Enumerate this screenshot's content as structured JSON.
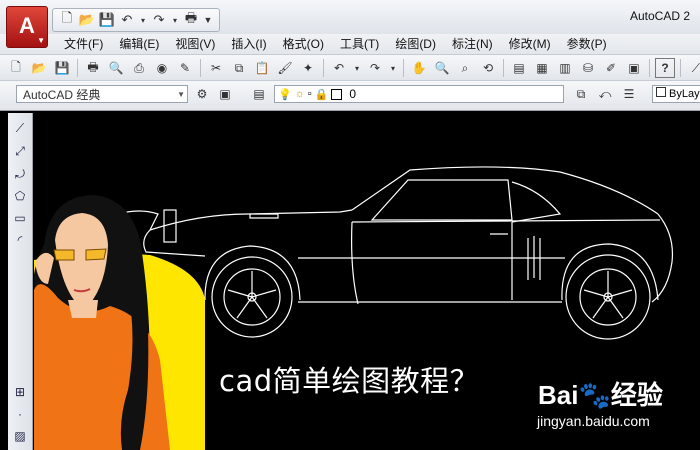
{
  "app": {
    "logo_letter": "A",
    "window_title": "AutoCAD 2"
  },
  "menu": {
    "items": [
      "文件(F)",
      "编辑(E)",
      "视图(V)",
      "插入(I)",
      "格式(O)",
      "工具(T)",
      "绘图(D)",
      "标注(N)",
      "修改(M)",
      "参数(P)"
    ]
  },
  "toolbar2": {
    "workspace": "AutoCAD 经典",
    "layer_value": "0",
    "linetype": "ByLay"
  },
  "overlay": {
    "caption": "cad简单绘图教程？",
    "watermark_logo": "Bai🐾经验",
    "watermark_url": "jingyan.baidu.com"
  },
  "colors": {
    "canvas": "#000000",
    "line": "#ffffff",
    "logo_red": "#c62020",
    "yellow": "#ffe600",
    "orange": "#f07316"
  }
}
